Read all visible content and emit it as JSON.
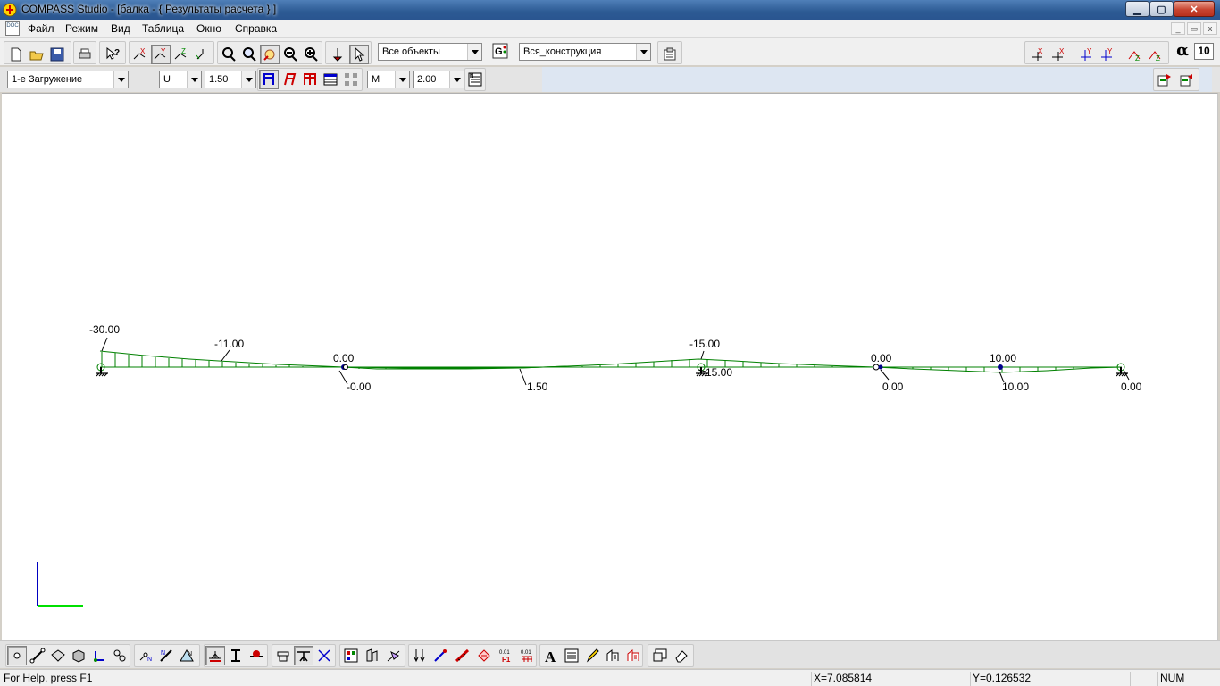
{
  "window": {
    "title": "COMPASS  Studio - [балка - { Результаты расчета } ]",
    "minimize": "▁",
    "maximize": "▢",
    "close": "✕"
  },
  "menu": {
    "items": [
      "Файл",
      "Режим",
      "Вид",
      "Таблица",
      "Окно",
      "Справка"
    ],
    "mdi_controls": [
      "_",
      "▭",
      "x"
    ]
  },
  "toolbar1": {
    "filter_objects": "Все объекты",
    "group_label": "G",
    "construction": "Вся_конструкция",
    "alpha_symbol": "α",
    "alpha_value": "10"
  },
  "toolbar2": {
    "load_case": "1-е Загружение",
    "displacement": "U",
    "displacement_scale": "1.50",
    "force": "M",
    "force_scale": "2.00"
  },
  "icons": {
    "toolbar1": [
      "new-file-icon",
      "open-file-icon",
      "save-icon",
      "print-icon",
      "help-cursor-icon",
      "select-x-icon",
      "select-y-icon",
      "select-z-icon",
      "select-all-icon",
      "zoom-icon",
      "zoom-window-icon",
      "pan-icon",
      "zoom-out-icon",
      "zoom-in-icon",
      "pin-icon",
      "pointer-icon",
      "group-icon",
      "properties-icon"
    ],
    "toolbar1_right": [
      "rotate-x-plus-icon",
      "rotate-x-minus-icon",
      "rotate-y-plus-icon",
      "rotate-y-minus-icon",
      "rotate-z-plus-icon",
      "rotate-z-minus-icon"
    ],
    "toolbar2": [
      "frame-icon",
      "frame-italic-icon",
      "frame-red-icon",
      "table-icon",
      "grid-icon",
      "numbers-icon"
    ],
    "toolbar2_right": [
      "export-icon",
      "import-icon"
    ],
    "bottom": [
      "node-icon",
      "beam-icon",
      "plate-icon",
      "solid-icon",
      "axes-icon",
      "link-icon",
      "node-number-icon",
      "element-number-icon",
      "node-name-icon",
      "support-fix-icon",
      "support-hinge-icon",
      "support-load-icon",
      "section-icon",
      "top-view-icon",
      "diagonal-icon",
      "materials-icon",
      "material-type-icon",
      "material-load-icon",
      "force-down-icon",
      "force-curve-icon",
      "force-ruler-icon",
      "force-pattern-icon",
      "load-f1-icon",
      "load-grid-icon",
      "text-icon",
      "list-icon",
      "pencil-icon",
      "building-icon",
      "building-red-icon",
      "view-window-icon",
      "eraser-icon"
    ]
  },
  "diagram": {
    "beam_color": "#008000",
    "axis_x_color": "#00e000",
    "axis_y_color": "#0000c0",
    "labels_top": [
      "-30.00",
      "-11.00",
      "0.00",
      "-15.00",
      "0.00",
      "10.00"
    ],
    "labels_bottom": [
      "-0.00",
      "1.50",
      "15.00",
      "0.00",
      "10.00",
      "0.00"
    ]
  },
  "status": {
    "help": "For Help, press F1",
    "x": "X=7.085814",
    "y": "Y=0.126532",
    "num": "NUM"
  }
}
